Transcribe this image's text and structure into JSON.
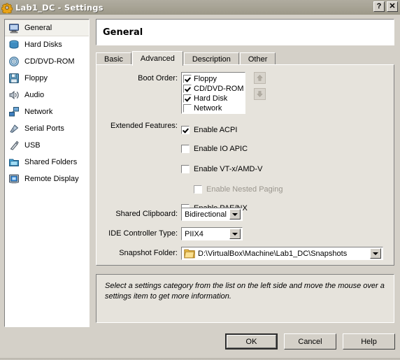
{
  "window": {
    "title": "Lab1_DC - Settings",
    "title_icon": "gear-icon",
    "help_button": "?",
    "close_button": "✕"
  },
  "sidebar": {
    "items": [
      {
        "label": "General",
        "icon": "monitor-icon",
        "selected": true
      },
      {
        "label": "Hard Disks",
        "icon": "harddisk-icon",
        "selected": false
      },
      {
        "label": "CD/DVD-ROM",
        "icon": "cd-icon",
        "selected": false
      },
      {
        "label": "Floppy",
        "icon": "floppy-icon",
        "selected": false
      },
      {
        "label": "Audio",
        "icon": "speaker-icon",
        "selected": false
      },
      {
        "label": "Network",
        "icon": "network-icon",
        "selected": false
      },
      {
        "label": "Serial Ports",
        "icon": "serial-port-icon",
        "selected": false
      },
      {
        "label": "USB",
        "icon": "usb-icon",
        "selected": false
      },
      {
        "label": "Shared Folders",
        "icon": "shared-folder-icon",
        "selected": false
      },
      {
        "label": "Remote Display",
        "icon": "remote-display-icon",
        "selected": false
      }
    ]
  },
  "page": {
    "title": "General",
    "tabs": [
      {
        "label": "Basic",
        "active": false
      },
      {
        "label": "Advanced",
        "active": true
      },
      {
        "label": "Description",
        "active": false
      },
      {
        "label": "Other",
        "active": false
      }
    ]
  },
  "advanced": {
    "boot_order": {
      "label": "Boot Order:",
      "items": [
        {
          "label": "Floppy",
          "checked": true
        },
        {
          "label": "CD/DVD-ROM",
          "checked": true
        },
        {
          "label": "Hard Disk",
          "checked": true
        },
        {
          "label": "Network",
          "checked": false
        }
      ],
      "move_up": "move-up",
      "move_down": "move-down"
    },
    "extended_features": {
      "label": "Extended Features:",
      "items": [
        {
          "label": "Enable ACPI",
          "checked": true,
          "disabled": false,
          "indented": false
        },
        {
          "label": "Enable IO APIC",
          "checked": false,
          "disabled": false,
          "indented": false
        },
        {
          "label": "Enable VT-x/AMD-V",
          "checked": false,
          "disabled": false,
          "indented": false
        },
        {
          "label": "Enable Nested Paging",
          "checked": false,
          "disabled": true,
          "indented": true
        },
        {
          "label": "Enable PAE/NX",
          "checked": false,
          "disabled": false,
          "indented": false
        }
      ]
    },
    "shared_clipboard": {
      "label": "Shared Clipboard:",
      "value": "Bidirectional"
    },
    "ide_controller_type": {
      "label": "IDE Controller Type:",
      "value": "PIIX4"
    },
    "snapshot_folder": {
      "label": "Snapshot Folder:",
      "value": "D:\\VirtualBox\\Machine\\Lab1_DC\\Snapshots",
      "icon": "folder-icon"
    }
  },
  "info": {
    "text": "Select a settings category from the list on the left side and move the mouse over a settings item to get more information."
  },
  "buttons": {
    "ok": "OK",
    "cancel": "Cancel",
    "help": "Help"
  },
  "colors": {
    "dialog_face": "#d4d0c8",
    "panel_face": "#e6e3dc",
    "titlebar": "#a8a496",
    "field_white": "#ffffff",
    "disabled_text": "#9a968e"
  }
}
